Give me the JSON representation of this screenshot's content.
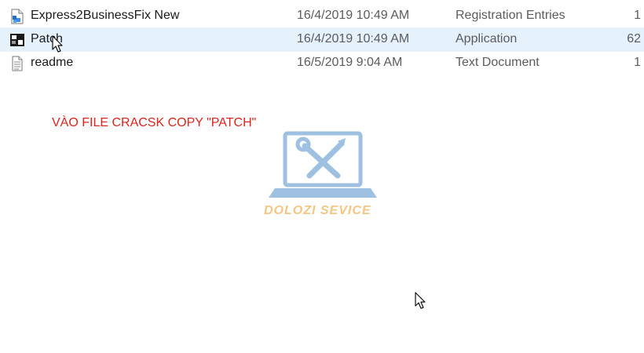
{
  "files": [
    {
      "name": "Express2BusinessFix New",
      "date": "16/4/2019 10:49 AM",
      "type": "Registration Entries",
      "size": "1",
      "icon": "registry-file-icon",
      "selected": false
    },
    {
      "name": "Patch",
      "date": "16/4/2019 10:49 AM",
      "type": "Application",
      "size": "62",
      "icon": "application-icon",
      "selected": true
    },
    {
      "name": "readme",
      "date": "16/5/2019 9:04 AM",
      "type": "Text Document",
      "size": "1",
      "icon": "text-document-icon",
      "selected": false
    }
  ],
  "annotation": "VÀO FILE CRACSK COPY \"PATCH\"",
  "watermark": {
    "text": "DOLOZI SEVICE",
    "icon": "laptop-tools-icon"
  },
  "colors": {
    "selection": "#e5f1fb",
    "annotation": "#e0231b",
    "watermark_text": "#f0b35a",
    "watermark_icon": "#4f8fc9"
  }
}
